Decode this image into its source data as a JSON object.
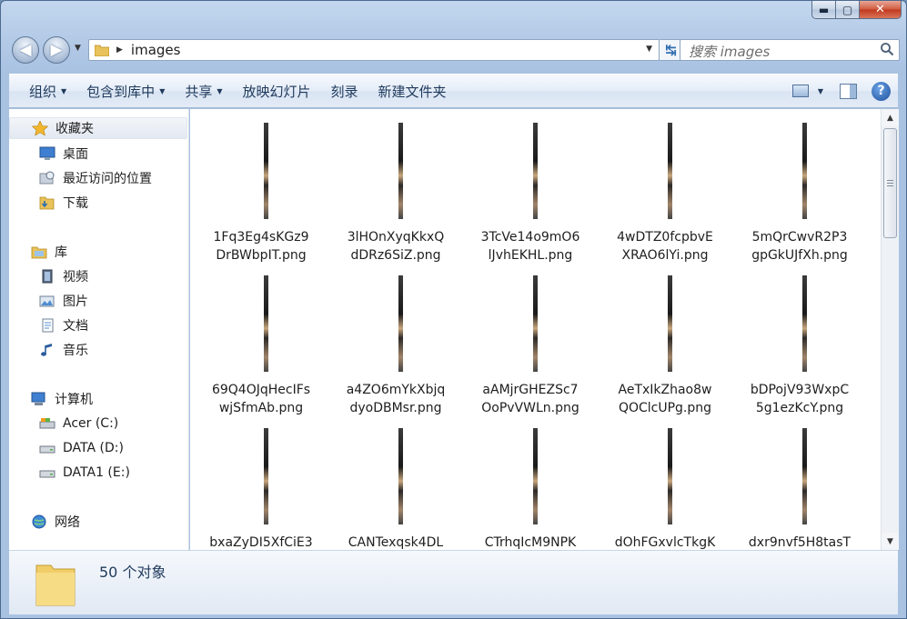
{
  "window": {
    "caption": {
      "minimize": "▬",
      "maximize": "▢",
      "close": "✕"
    }
  },
  "navbar": {
    "address": "images",
    "search_placeholder": "搜索 images"
  },
  "toolbar": {
    "items": [
      {
        "label": "组织",
        "has_dropdown": true
      },
      {
        "label": "包含到库中",
        "has_dropdown": true
      },
      {
        "label": "共享",
        "has_dropdown": true
      },
      {
        "label": "放映幻灯片",
        "has_dropdown": false
      },
      {
        "label": "刻录",
        "has_dropdown": false
      },
      {
        "label": "新建文件夹",
        "has_dropdown": false
      }
    ],
    "help": "?"
  },
  "sidebar": {
    "favorites": {
      "label": "收藏夹",
      "items": [
        "桌面",
        "最近访问的位置",
        "下载"
      ]
    },
    "libraries": {
      "label": "库",
      "items": [
        "视频",
        "图片",
        "文档",
        "音乐"
      ]
    },
    "computer": {
      "label": "计算机",
      "items": [
        "Acer (C:)",
        "DATA (D:)",
        "DATA1 (E:)"
      ]
    },
    "network": {
      "label": "网络"
    }
  },
  "files": [
    {
      "line1": "1Fq3Eg4sKGz9",
      "line2": "DrBWbpIT.png"
    },
    {
      "line1": "3lHOnXyqKkxQ",
      "line2": "dDRz6SiZ.png"
    },
    {
      "line1": "3TcVe14o9mO6",
      "line2": "lJvhEKHL.png"
    },
    {
      "line1": "4wDTZ0fcpbvE",
      "line2": "XRAO6lYi.png"
    },
    {
      "line1": "5mQrCwvR2P3",
      "line2": "gpGkUJfXh.png"
    },
    {
      "line1": "69Q4OJqHecIFs",
      "line2": "wjSfmAb.png"
    },
    {
      "line1": "a4ZO6mYkXbjq",
      "line2": "dyoDBMsr.png"
    },
    {
      "line1": "aAMjrGHEZSc7",
      "line2": "OoPvVWLn.png"
    },
    {
      "line1": "AeTxIkZhao8w",
      "line2": "QOClcUPg.png"
    },
    {
      "line1": "bDPojV93WxpC",
      "line2": "5g1ezKcY.png"
    },
    {
      "line1": "bxaZyDI5XfCiE3",
      "line2": ""
    },
    {
      "line1": "CANTexqsk4DL",
      "line2": ""
    },
    {
      "line1": "CTrhqIcM9NPK",
      "line2": ""
    },
    {
      "line1": "dOhFGxvlcTkgK",
      "line2": ""
    },
    {
      "line1": "dxr9nvf5H8tasT",
      "line2": ""
    }
  ],
  "status": {
    "count": "50 个对象"
  },
  "colors": {
    "accent": "#1e395b",
    "window_frame": "#b4cbe7",
    "content_bg": "#ffffff"
  }
}
